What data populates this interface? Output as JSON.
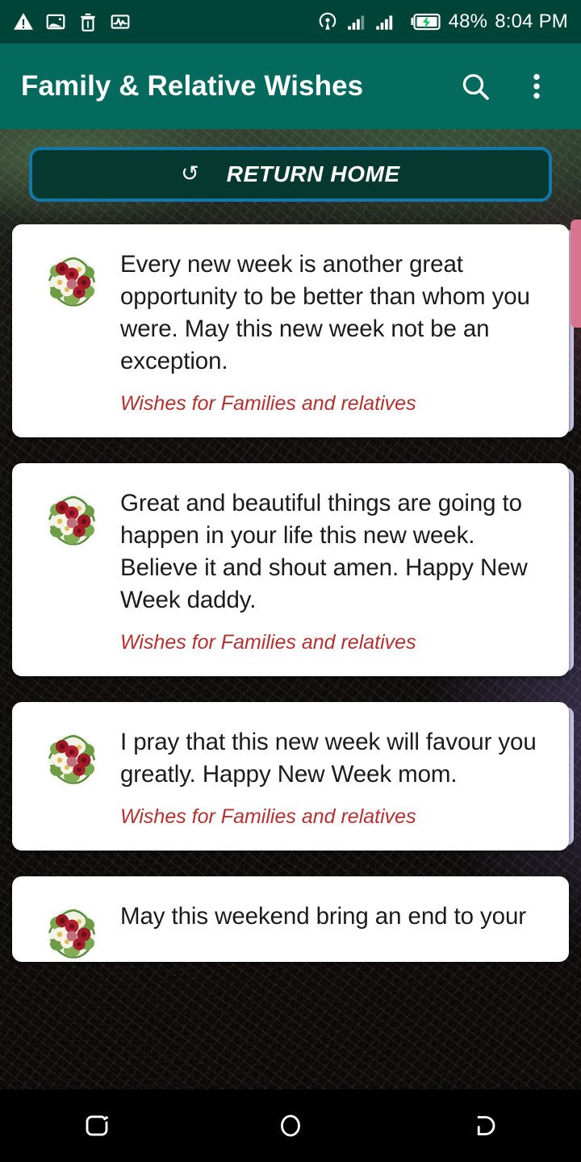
{
  "status_bar": {
    "icons": [
      "warning-triangle-icon",
      "image-icon",
      "trash-icon",
      "activity-pulse-icon",
      "hotspot-icon",
      "signal-bars-icon-1",
      "signal-bars-icon-2",
      "battery-charging-icon"
    ],
    "battery_percent": "48%",
    "time": "8:04 PM",
    "background_color": "#004438",
    "foreground_color": "#ffffff",
    "battery_bolt_color": "#00c853"
  },
  "app_bar": {
    "title": "Family & Relative Wishes",
    "search_icon": "search-icon",
    "overflow_icon": "more-vertical-icon",
    "background_color": "#046a5d",
    "title_color": "#ffffff"
  },
  "return_button": {
    "label": "RETURN HOME",
    "icon": "refresh-rotate-icon",
    "icon_glyph": "↺",
    "border_color": "#1378a8",
    "fill_color": "#05382f",
    "text_color": "#ffffff"
  },
  "list": {
    "thumb_icon": "flower-bouquet-icon",
    "card_background": "#ffffff",
    "text_color": "#1b1b1b",
    "subtitle_color": "#b5302f",
    "accent_edge_color": "#c9c4e6",
    "items": [
      {
        "text": "Every new week is another great opportunity to be better than whom you were. May this new week not be an exception.",
        "subtitle": "Wishes for Families and relatives"
      },
      {
        "text": "Great and beautiful things are going to happen in your life this new week. Believe it and shout amen. Happy New Week daddy.",
        "subtitle": "Wishes for Families and relatives"
      },
      {
        "text": "I pray that this new week will favour you greatly. Happy New Week mom.",
        "subtitle": "Wishes for Families and relatives"
      },
      {
        "text": "May this weekend bring an end to your",
        "subtitle": ""
      }
    ]
  },
  "scrollbar": {
    "thumb_color": "#d9748f",
    "position": "top"
  },
  "nav_bar": {
    "background_color": "#000000",
    "buttons": [
      "recents-icon",
      "home-icon",
      "back-icon"
    ]
  }
}
